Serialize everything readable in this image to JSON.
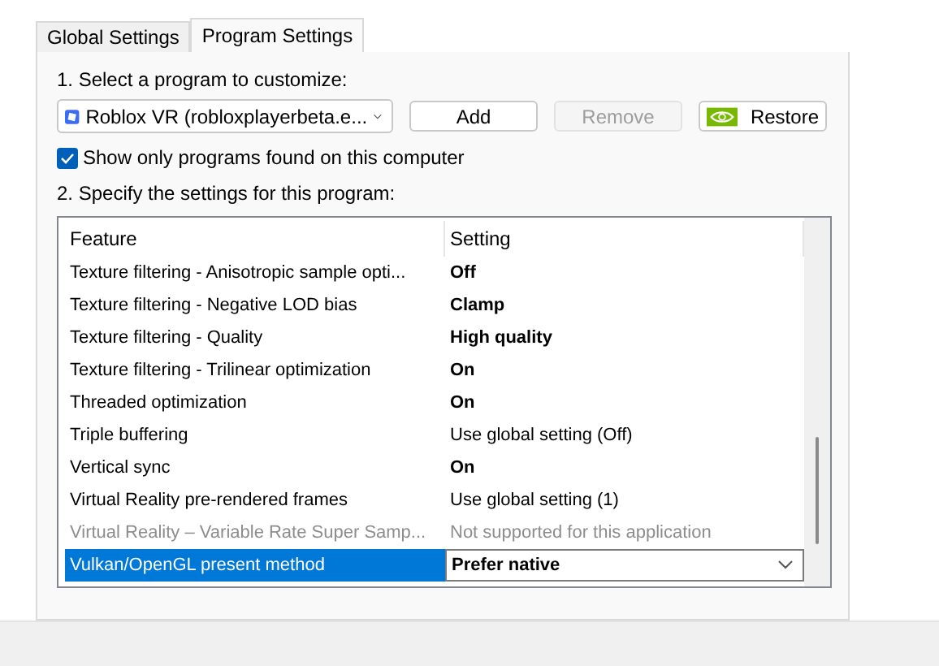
{
  "tabs": [
    {
      "label": "Global Settings",
      "selected": false
    },
    {
      "label": "Program Settings",
      "selected": true
    }
  ],
  "step1_label": "1. Select a program to customize:",
  "program_select": {
    "value": "Roblox VR (robloxplayerbeta.e..."
  },
  "buttons": [
    {
      "label": "Add",
      "disabled": false,
      "kind": "plain"
    },
    {
      "label": "Remove",
      "disabled": true,
      "kind": "plain"
    },
    {
      "label": "Restore",
      "disabled": false,
      "kind": "logo"
    }
  ],
  "show_only_found": {
    "label": "Show only programs found on this computer",
    "checked": true
  },
  "step2_label": "2. Specify the settings for this program:",
  "table": {
    "columns": [
      "Feature",
      "Setting"
    ],
    "rows": [
      {
        "feature": "Texture filtering - Anisotropic sample opti...",
        "setting": "Off",
        "bold": true,
        "disabled": false,
        "selected": false
      },
      {
        "feature": "Texture filtering - Negative LOD bias",
        "setting": "Clamp",
        "bold": true,
        "disabled": false,
        "selected": false
      },
      {
        "feature": "Texture filtering - Quality",
        "setting": "High quality",
        "bold": true,
        "disabled": false,
        "selected": false
      },
      {
        "feature": "Texture filtering - Trilinear optimization",
        "setting": "On",
        "bold": true,
        "disabled": false,
        "selected": false
      },
      {
        "feature": "Threaded optimization",
        "setting": "On",
        "bold": true,
        "disabled": false,
        "selected": false
      },
      {
        "feature": "Triple buffering",
        "setting": "Use global setting (Off)",
        "bold": false,
        "disabled": false,
        "selected": false
      },
      {
        "feature": "Vertical sync",
        "setting": "On",
        "bold": true,
        "disabled": false,
        "selected": false
      },
      {
        "feature": "Virtual Reality pre-rendered frames",
        "setting": "Use global setting (1)",
        "bold": false,
        "disabled": false,
        "selected": false
      },
      {
        "feature": "Virtual Reality – Variable Rate Super Samp...",
        "setting": "Not supported for this application",
        "bold": false,
        "disabled": true,
        "selected": false
      },
      {
        "feature": "Vulkan/OpenGL present method",
        "setting": "Prefer native",
        "bold": true,
        "disabled": false,
        "selected": true
      }
    ]
  }
}
